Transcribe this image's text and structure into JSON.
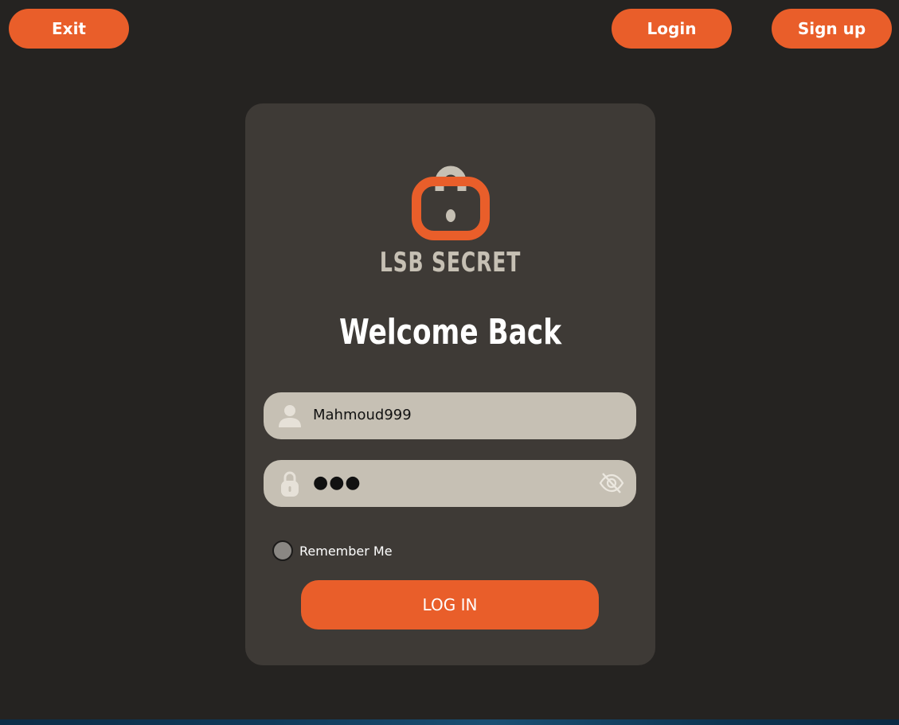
{
  "topbar": {
    "exit_label": "Exit",
    "login_label": "Login",
    "signup_label": "Sign up"
  },
  "logo": {
    "text": "LSB SECRET",
    "icon": "lock-logo-icon"
  },
  "form": {
    "heading": "Welcome Back",
    "username": {
      "value": "Mahmoud999",
      "icon": "user-icon"
    },
    "password": {
      "masked_value": "●●●",
      "icon": "lock-icon",
      "toggle_icon": "eye-slash-icon"
    },
    "remember_label": "Remember Me",
    "remember_checked": false,
    "submit_label": "LOG IN"
  },
  "colors": {
    "accent": "#e95e2a",
    "background": "#252321",
    "card": "#3e3a36",
    "field": "#c6c0b4",
    "logo_gray": "#c6c0b4"
  }
}
